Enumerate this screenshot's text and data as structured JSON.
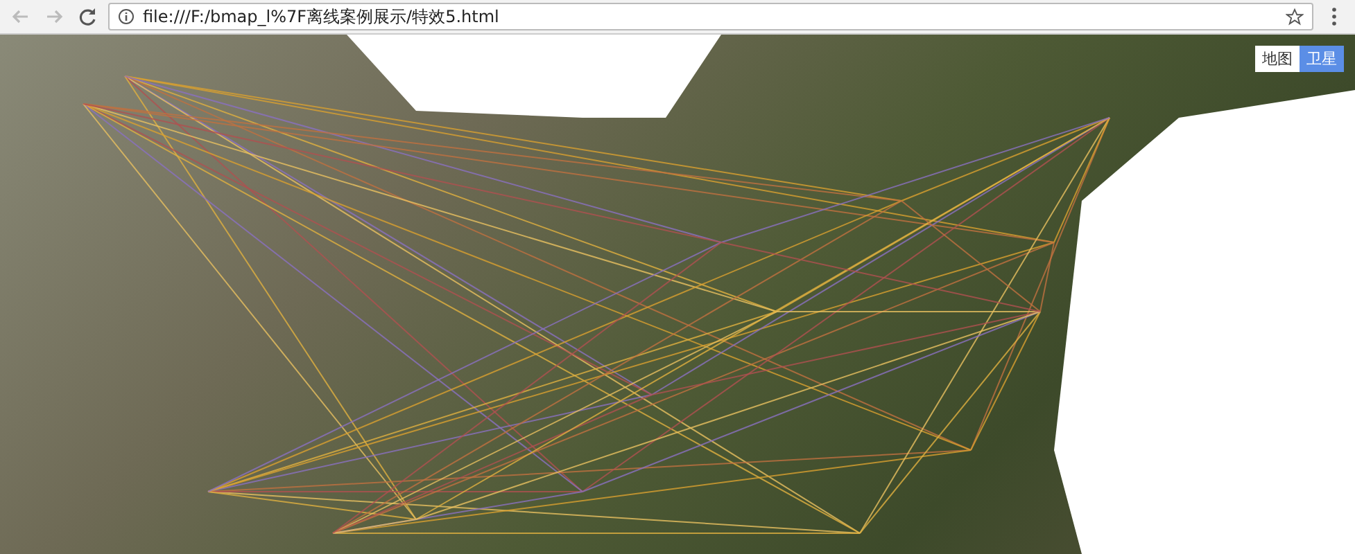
{
  "browser": {
    "url": "file:///F:/bmap_l%7F离线案例展示/特效5.html"
  },
  "map": {
    "type_control": [
      {
        "label": "地图",
        "selected": false
      },
      {
        "label": "卫星",
        "selected": true
      }
    ]
  }
}
